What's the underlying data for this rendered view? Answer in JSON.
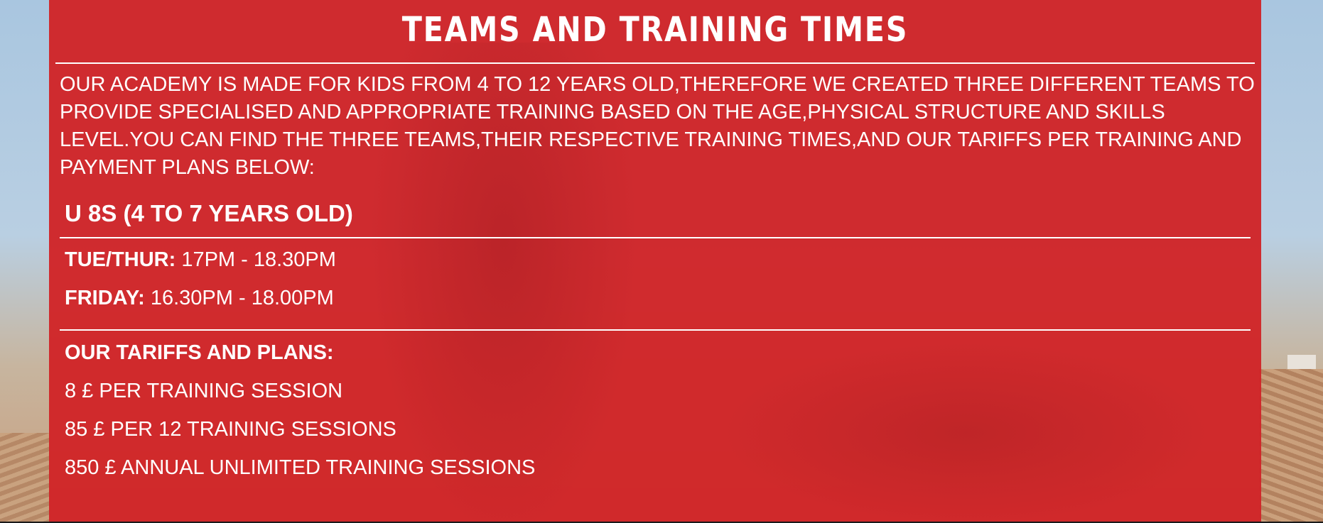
{
  "title": "TEAMS AND TRAINING TIMES",
  "intro": "OUR ACADEMY IS MADE FOR KIDS FROM 4 TO 12 YEARS OLD,THEREFORE WE CREATED THREE DIFFERENT TEAMS TO PROVIDE SPECIALISED AND APPROPRIATE TRAINING BASED ON THE AGE,PHYSICAL STRUCTURE AND SKILLS LEVEL.YOU CAN FIND THE THREE TEAMS,THEIR RESPECTIVE TRAINING TIMES,AND OUR TARIFFS PER TRAINING AND PAYMENT PLANS BELOW:",
  "team": {
    "heading": "U 8S (4 TO 7 YEARS OLD)",
    "schedule": [
      {
        "day": "TUE/THUR:",
        "time": " 17PM - 18.30PM"
      },
      {
        "day": "FRIDAY:",
        "time": " 16.30PM - 18.00PM"
      }
    ]
  },
  "tariffs": {
    "heading": "OUR TARIFFS AND PLANS:",
    "items": [
      "8 £ PER TRAINING SESSION",
      "85 £ PER 12 TRAINING SESSIONS",
      "850 £ ANNUAL UNLIMITED TRAINING SESSIONS"
    ]
  },
  "colors": {
    "panel": "#d02428",
    "text": "#ffffff"
  }
}
